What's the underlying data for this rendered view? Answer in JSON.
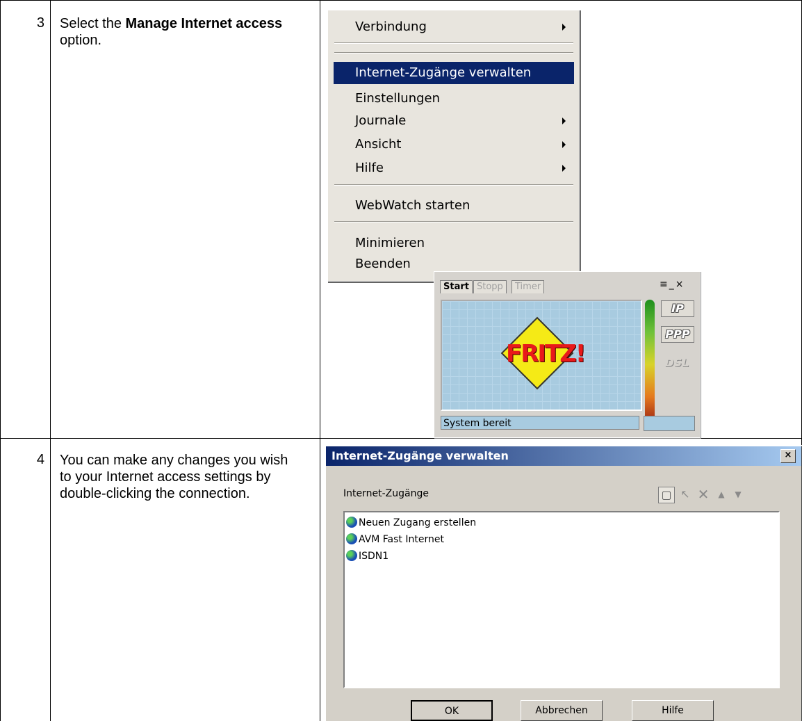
{
  "steps": [
    {
      "number": "3",
      "text_pre": "Select the ",
      "text_bold": "Manage Internet access",
      "text_post": " option."
    },
    {
      "number": "4",
      "text": "You can make any changes you wish to your Internet access settings by double-clicking the connection."
    }
  ],
  "menu": {
    "items": {
      "verbindung": "Verbindung",
      "manage": "Internet-Zugänge verwalten",
      "einstellungen": "Einstellungen",
      "journale": "Journale",
      "ansicht": "Ansicht",
      "hilfe": "Hilfe",
      "webwatch": "WebWatch starten",
      "minimieren": "Minimieren",
      "beenden": "Beenden"
    }
  },
  "fritz": {
    "tabs": [
      "Start",
      "Stopp",
      "Timer"
    ],
    "window_buttons": "≡_×",
    "logo": "FRITZ!",
    "badges": [
      "IP",
      "PPP",
      "DSL"
    ],
    "status": "System bereit"
  },
  "dialog": {
    "title": "Internet-Zugänge verwalten",
    "close": "×",
    "group_label": "Internet-Zugänge",
    "items": [
      "Neuen Zugang erstellen",
      "AVM Fast Internet",
      "ISDN1"
    ],
    "buttons": {
      "ok": "OK",
      "cancel": "Abbrechen",
      "help": "Hilfe"
    }
  }
}
